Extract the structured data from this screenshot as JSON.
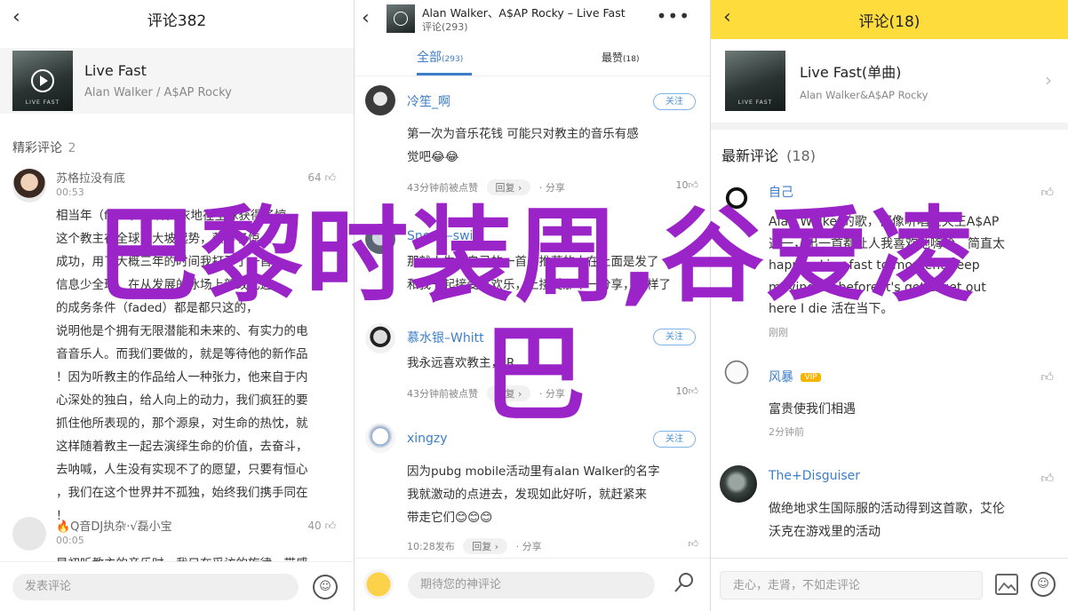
{
  "panel1": {
    "title": "评论382",
    "song": {
      "name": "Live Fast",
      "artist": "Alan Walker / A$AP Rocky",
      "cover_caption": "LIVE FAST"
    },
    "section_label": "精彩评论",
    "section_count": "2",
    "comments": [
      {
        "user": "苏格拉没有底",
        "time": "00:53",
        "likes": "64",
        "lines": [
          "相当年（fade）一种天衣地在全球获得了惊",
          "这个教主在全球的大坡起势，获得了惊人",
          "成功，用了大概三年的时间我打开了一首",
          "信息少全球，在从发展的冰场上新改化这",
          "的成务条件（faded）都是都只这的，",
          "说明他是个拥有无限潜能和未来的、有实力的电",
          "音音乐人。而我们要做的，就是等待他的新作品",
          "！因为听教主的作品给人一种张力，他来自于内",
          "心深处的独白，给人向上的动力，我们疯狂的要",
          "抓住他所表现的，那个源泉，对生命的热忱，就",
          "这样随着教主一起去演绎生命的价值，去奋斗，",
          "去呐喊，人生没有实现不了的愿望，只要有恒心",
          "，我们在这个世界并不孤独，始终我们携手同在",
          "！"
        ]
      },
      {
        "user": "🔥Q音DJ执杂·√磊小宝",
        "time": "00:05",
        "likes": "40",
        "lines": [
          "是初听教主的音乐时，我只在采访的旋律，带感"
        ]
      }
    ],
    "input_placeholder": "发表评论"
  },
  "panel2": {
    "header_title": "Alan Walker、A$AP Rocky – Live Fast",
    "header_sub": "评论(293)",
    "tabs": [
      {
        "label": "全部",
        "count": "293",
        "active": true
      },
      {
        "label": "最赞",
        "count": "18",
        "active": false
      }
    ],
    "follow_label": "关注",
    "reply_label": "回复",
    "share_label": "分享",
    "comments": [
      {
        "user": "冷笙_啊",
        "lines": [
          "第一次为音乐花钱   可能只对教主的音乐有感",
          "觉吧😂😂"
        ],
        "meta": "43分钟前被点赞",
        "likes": "10"
      },
      {
        "user": "Snow—swift",
        "lines": [
          "那就人生要自己的一首，推荐的人在上面是发了",
          "和我一起接受过欢乐，上接受那个一分享，但样了"
        ],
        "meta": "",
        "likes": ""
      },
      {
        "user": "慕水银–Whitt",
        "lines": [
          "我永远喜欢教主，JR"
        ],
        "meta": "43分钟前被点赞",
        "likes": "10"
      },
      {
        "user": "xingzy",
        "lines": [
          "因为pubg mobile活动里有alan Walker的名字",
          "我就激动的点进去，发现如此好听，就赶紧来",
          "带走它们😊😊😊"
        ],
        "meta": "10:28发布",
        "likes": ""
      }
    ],
    "input_placeholder": "期待您的神评论"
  },
  "panel3": {
    "title": "评论(18)",
    "song": {
      "name": "Live Fast(单曲)",
      "artist": "Alan Walker&A$AP Rocky",
      "cover_caption": "LIVE FAST"
    },
    "section_label": "最新评论",
    "section_count": "(18)",
    "comments": [
      {
        "user": "自己",
        "lines": [
          "Alan Walker的歌，都像听唱王天王A$AP",
          "这一，出一首都让人我喜欢地嗨哈，简直太",
          "happy，Live fast to moment Keep",
          "moving on before it's gotta get out",
          "here I die 活在当下。"
        ],
        "time": "刚刚"
      },
      {
        "user": "风暴",
        "badge": "VIP",
        "lines": [
          "富贵使我们相遇"
        ],
        "time": "2分钟前"
      },
      {
        "user": "The+Disguiser",
        "lines": [
          "做绝地求生国际服的活动得到这首歌，艾伦",
          "沃克在游戏里的活动"
        ],
        "time": ""
      }
    ],
    "input_placeholder": "走心，走肾，不如走评论"
  },
  "overlay": {
    "line1": "巴黎时装周,谷爱凌",
    "line2": "巴"
  },
  "colors": {
    "accent_yellow": "#fddc3c",
    "overlay_purple": "#9b24c9",
    "link_blue": "#3c7ec8",
    "follow_blue": "#4b93d9"
  }
}
